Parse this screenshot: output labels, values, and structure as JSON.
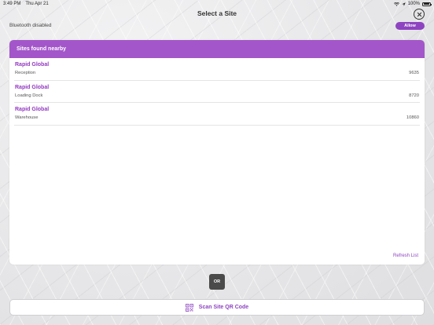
{
  "status_bar": {
    "time": "3:49 PM",
    "date": "Thu Apr 21",
    "battery": "100%"
  },
  "header": {
    "title": "Select a Site"
  },
  "bluetooth": {
    "status_text": "Bluetooth disabled",
    "allow_label": "Allow"
  },
  "sites_card": {
    "title": "Sites found nearby",
    "sites": [
      {
        "name": "Rapid Global",
        "description": "Reception",
        "id": "9635"
      },
      {
        "name": "Rapid Global",
        "description": "Loading Dock",
        "id": "8720"
      },
      {
        "name": "Rapid Global",
        "description": "Warehouse",
        "id": "10860"
      }
    ],
    "refresh_label": "Refresh List"
  },
  "divider": {
    "or_label": "OR"
  },
  "scan": {
    "label": "Scan Site QR Code",
    "icon": "qr-code-icon"
  },
  "colors": {
    "accent": "#8e44c1",
    "card_header": "#a356c9",
    "or_badge": "#4a4a4a"
  }
}
